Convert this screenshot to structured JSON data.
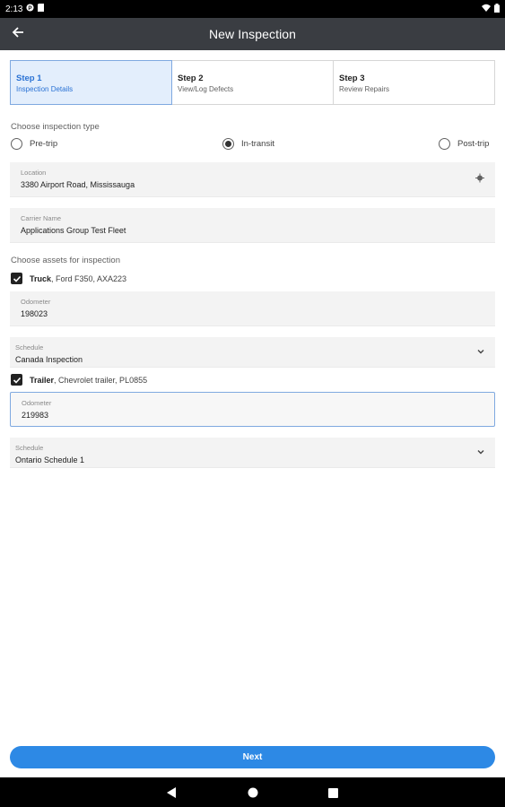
{
  "status_bar": {
    "time": "2:13"
  },
  "app_bar": {
    "title": "New Inspection"
  },
  "steps": [
    {
      "title": "Step 1",
      "subtitle": "Inspection Details"
    },
    {
      "title": "Step 2",
      "subtitle": "View/Log Defects"
    },
    {
      "title": "Step 3",
      "subtitle": "Review Repairs"
    }
  ],
  "inspection_type": {
    "label": "Choose inspection type",
    "options": [
      "Pre-trip",
      "In-transit",
      "Post-trip"
    ],
    "selected": "In-transit"
  },
  "location": {
    "label": "Location",
    "value": "3380 Airport Road, Mississauga"
  },
  "carrier": {
    "label": "Carrier Name",
    "value": "Applications Group Test Fleet"
  },
  "assets": {
    "label": "Choose assets for inspection",
    "truck": {
      "type": "Truck",
      "description": ", Ford F350, AXA223",
      "checked": true,
      "odometer_label": "Odometer",
      "odometer_value": "198023",
      "schedule_label": "Schedule",
      "schedule_value": "Canada Inspection"
    },
    "trailer": {
      "type": "Trailer",
      "description": ", Chevrolet trailer, PL0855",
      "checked": true,
      "odometer_label": "Odometer",
      "odometer_value": "219983",
      "schedule_label": "Schedule",
      "schedule_value": "Ontario Schedule 1"
    }
  },
  "next_button": {
    "label": "Next"
  },
  "colors": {
    "app_bar": "#3a3d42",
    "accent": "#2d89e5",
    "step_active_bg": "#e3eefc",
    "field_bg": "#f3f3f3"
  },
  "icons": [
    "back-arrow-icon",
    "location-pin-icon",
    "chevron-down-icon",
    "checkmark-icon",
    "wifi-icon",
    "battery-icon",
    "nav-back-icon",
    "nav-home-icon",
    "nav-recents-icon"
  ]
}
